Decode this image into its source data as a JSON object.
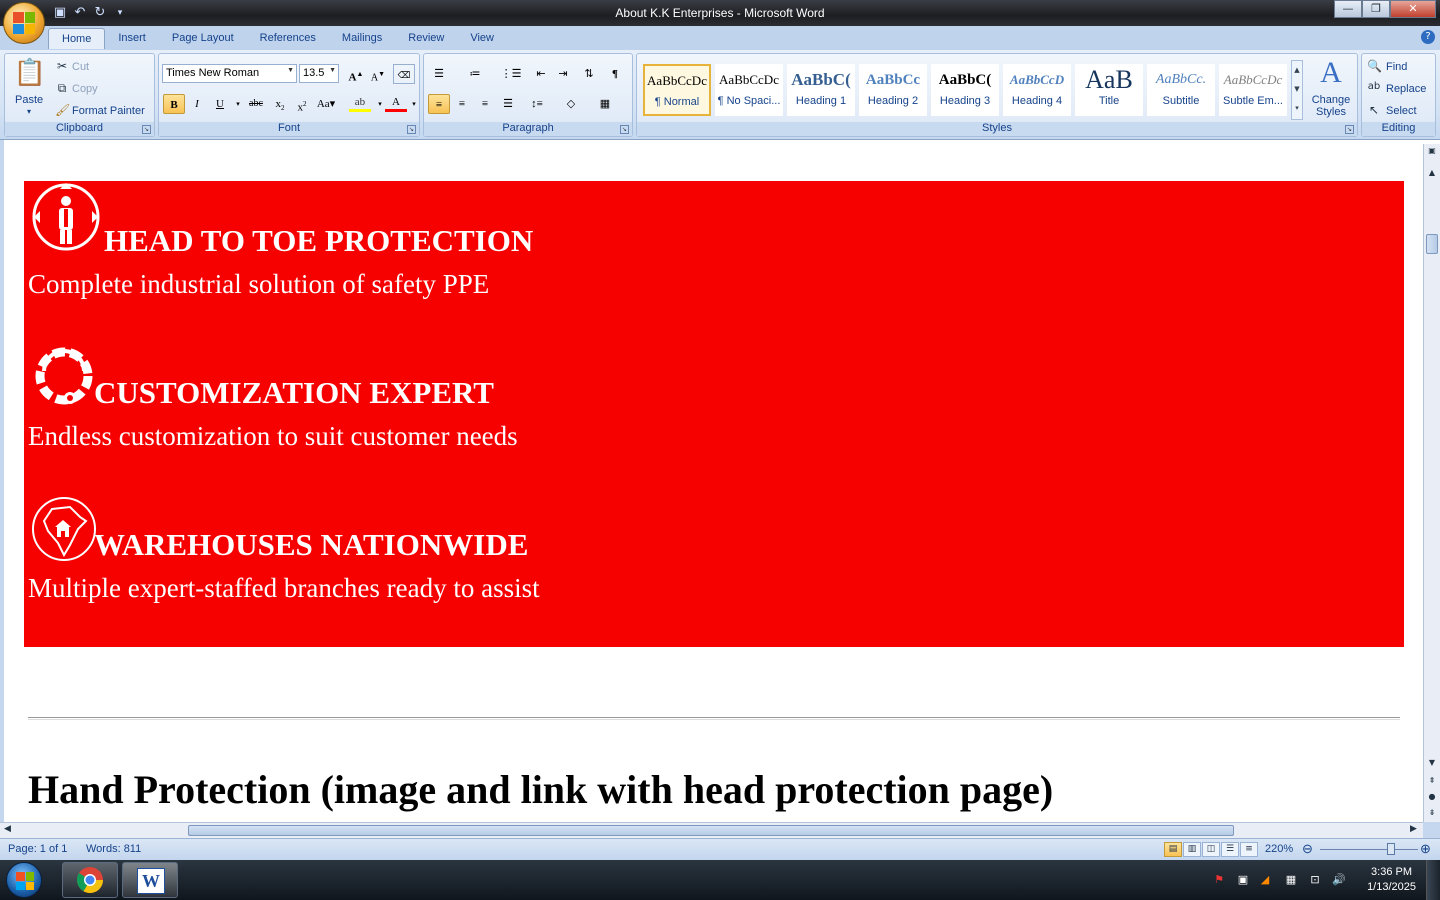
{
  "window": {
    "title": "About K.K Enterprises - Microsoft Word",
    "min": "—",
    "max": "❐",
    "close": "✕"
  },
  "tabs": [
    "Home",
    "Insert",
    "Page Layout",
    "References",
    "Mailings",
    "Review",
    "View"
  ],
  "clipboard": {
    "paste": "Paste",
    "cut": "Cut",
    "copy": "Copy",
    "format_painter": "Format Painter",
    "label": "Clipboard"
  },
  "font": {
    "family": "Times New Roman",
    "size": "13.5",
    "label": "Font"
  },
  "paragraph": {
    "label": "Paragraph"
  },
  "styles": {
    "label": "Styles",
    "items": [
      {
        "sample": "AaBbCcDc",
        "name": "¶ Normal"
      },
      {
        "sample": "AaBbCcDc",
        "name": "¶ No Spaci..."
      },
      {
        "sample": "AaBbC(",
        "name": "Heading 1"
      },
      {
        "sample": "AaBbCc",
        "name": "Heading 2"
      },
      {
        "sample": "AaBbC(",
        "name": "Heading 3"
      },
      {
        "sample": "AaBbCcD",
        "name": "Heading 4"
      },
      {
        "sample": "AaB",
        "name": "Title"
      },
      {
        "sample": "AaBbCc.",
        "name": "Subtitle"
      },
      {
        "sample": "AaBbCcDc",
        "name": "Subtle Em..."
      }
    ],
    "change_styles": "Change Styles"
  },
  "editing": {
    "find": "Find",
    "replace": "Replace",
    "select": "Select",
    "label": "Editing"
  },
  "document": {
    "features": [
      {
        "title": "HEAD TO TOE PROTECTION",
        "subtitle": "Complete industrial solution of safety PPE"
      },
      {
        "title": "CUSTOMIZATION EXPERT",
        "subtitle": "Endless customization to suit customer needs"
      },
      {
        "title": "WAREHOUSES NATIONWIDE",
        "subtitle": "Multiple expert-staffed branches ready to assist"
      }
    ],
    "heading": "Hand Protection (image and link with head protection page)"
  },
  "status": {
    "page": "Page: 1 of 1",
    "words": "Words: 811",
    "zoom": "220%",
    "zoom_fraction": 0.72
  },
  "taskbar": {
    "time": "3:36 PM",
    "date": "1/13/2025"
  },
  "colors": {
    "red_block": "#f60000",
    "ribbon": "#d3e2f4",
    "accent": "#15428b"
  }
}
